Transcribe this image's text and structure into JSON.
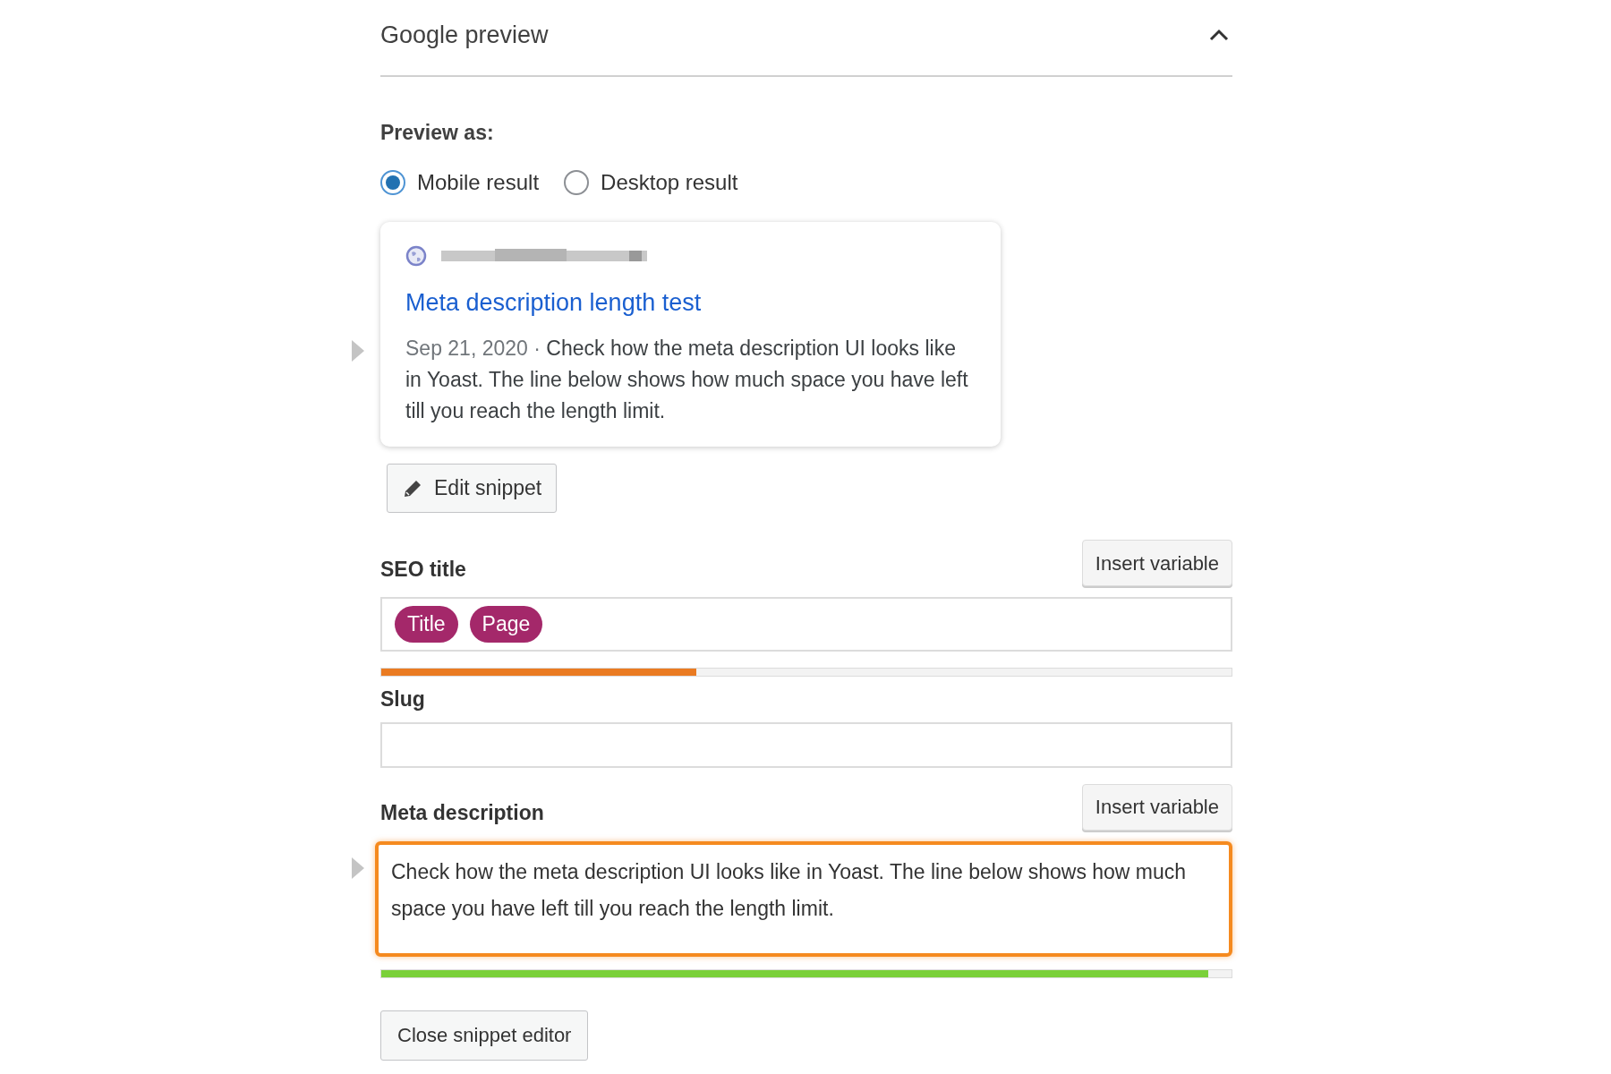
{
  "section": {
    "title": "Google preview",
    "expanded": true
  },
  "preview_as": {
    "label": "Preview as:",
    "options": [
      {
        "label": "Mobile result",
        "selected": true
      },
      {
        "label": "Desktop result",
        "selected": false
      }
    ]
  },
  "snippet": {
    "title": "Meta description length test",
    "date": "Sep 21, 2020",
    "separator": "·",
    "description": "Check how the meta description UI looks like in Yoast. The line below shows how much space you have left till you reach the length limit."
  },
  "edit_button": "Edit snippet",
  "fields": [
    {
      "kind": "variables",
      "label": "SEO title",
      "button": "Insert variable",
      "tags": [
        "Title",
        "Page"
      ],
      "focused": false,
      "meter": {
        "level": 0.37,
        "color": "#ea7b22"
      }
    },
    {
      "kind": "text",
      "label": "Slug",
      "focused": false
    },
    {
      "kind": "textarea",
      "label": "Meta description",
      "button": "Insert variable",
      "value": "Check how the meta description UI looks like in Yoast. The line below shows how much space you have left till you reach the length limit.",
      "focused": true,
      "meter": {
        "level": 0.973,
        "color": "#7ad03a"
      }
    }
  ],
  "close_button": "Close snippet editor"
}
